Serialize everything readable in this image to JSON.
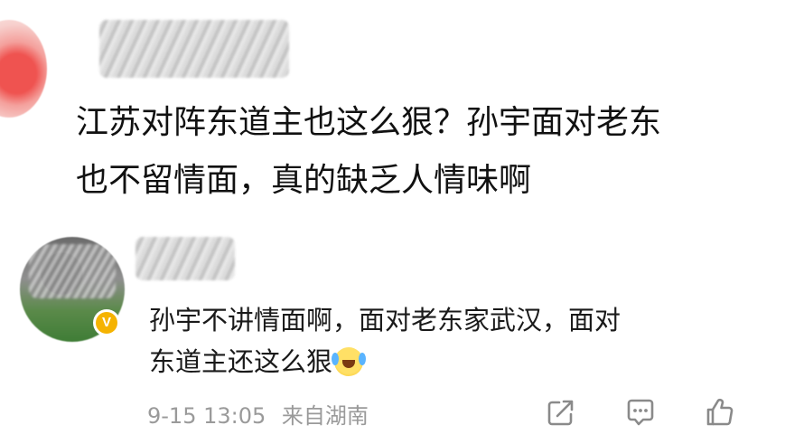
{
  "post": {
    "lines": [
      "江苏对阵东道主也这么狠？孙宇面对老东",
      "也不留情面，真的缺乏人情味啊"
    ]
  },
  "reply": {
    "badge": "V",
    "lines": [
      "孙宇不讲情面啊，面对老东家武汉，面对",
      "东道主还这么狠"
    ],
    "emoji": "laugh-crying-emoji",
    "time": "9-15 13:05",
    "source": "来自湖南"
  },
  "icons": [
    "share-icon",
    "comment-icon",
    "like-icon"
  ],
  "colors": {
    "text": "#111111",
    "meta": "#9a9a9a",
    "badge": "#f5b301"
  }
}
